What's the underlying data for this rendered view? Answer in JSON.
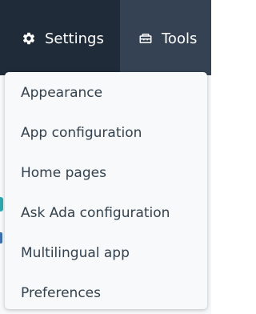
{
  "nav": {
    "settings": {
      "label": "Settings",
      "icon": "gear-icon"
    },
    "tools": {
      "label": "Tools",
      "icon": "toolbox-icon"
    }
  },
  "dropdown": {
    "items": [
      {
        "label": "Appearance"
      },
      {
        "label": "App configuration"
      },
      {
        "label": "Home pages"
      },
      {
        "label": "Ask Ada configuration"
      },
      {
        "label": "Multilingual app"
      },
      {
        "label": "Preferences"
      }
    ]
  },
  "colors": {
    "nav_active_bg": "#1f2b39",
    "nav_bg": "#344254",
    "menu_bg": "#f8f9fa",
    "menu_text": "#33414e",
    "accent_teal": "#2aa8b2"
  }
}
